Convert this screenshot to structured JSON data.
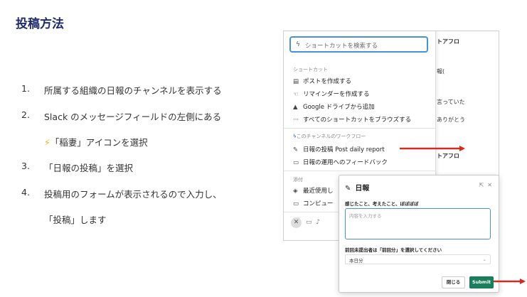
{
  "title": "投稿方法",
  "steps": [
    {
      "num": "1.",
      "text": "所属する組織の日報のチャンネルを表示する"
    },
    {
      "num": "2.",
      "text": "Slack のメッセージフィールドの左側にある"
    },
    {
      "num": "",
      "icon": "⚡",
      "text": "「稲妻」アイコンを選択"
    },
    {
      "num": "3.",
      "text": "「日報の投稿」を選択"
    },
    {
      "num": "4.",
      "text": "投稿用のフォームが表示されるので入力し、"
    },
    {
      "num": "",
      "text": "「投稿」します"
    }
  ],
  "slack": {
    "search_placeholder": "ショートカットを検索する",
    "shortcuts_section": "ショートカット",
    "shortcuts": [
      {
        "icon": "▤",
        "label": "ポストを作成する"
      },
      {
        "icon": "☜",
        "label": "リマインダーを作成する"
      },
      {
        "icon": "▲",
        "label": "Google ドライブから追加"
      },
      {
        "icon": "···",
        "label": "すべてのショートカットをブラウズする"
      }
    ],
    "workflow_section": "このチャンネルのワークフロー",
    "workflows": [
      {
        "icon": "✎",
        "label": "日報の投稿 Post daily report"
      },
      {
        "icon": "▭",
        "label": "日報の運用へのフィードバック"
      }
    ],
    "attach_section": "添付",
    "attach": [
      {
        "icon": "◈",
        "label": "最近使用し"
      },
      {
        "icon": "▭",
        "label": "コンピュー"
      }
    ],
    "bg_fragments": [
      "トアフロ",
      "報(",
      "言っていた",
      "ありがとう",
      "トアフロ"
    ]
  },
  "modal": {
    "title": "日報",
    "q1": "感じたこと、考えたこと、ぼぼぼぼ",
    "q1_placeholder": "内容を入力する",
    "q2": "前回未提出者は「前回分」を選択してください",
    "q2_value": "本日分",
    "close_label": "閉じる",
    "submit_label": "Submit"
  },
  "colors": {
    "title": "#1f2d6e",
    "arrow": "#d42a20",
    "submit": "#1a7f5a",
    "focus": "#4a90d9"
  }
}
